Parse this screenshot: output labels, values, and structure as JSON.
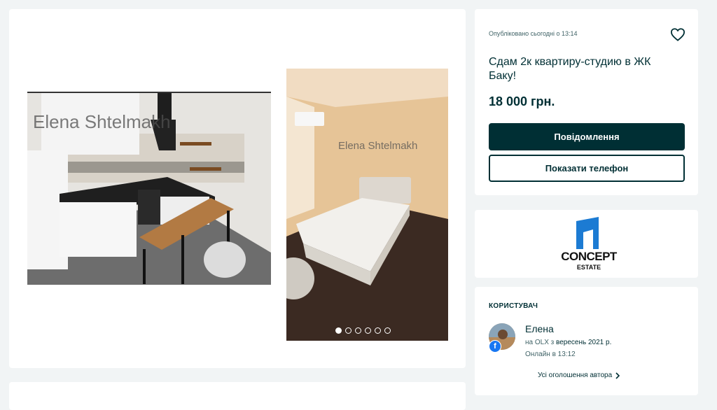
{
  "gallery": {
    "watermark_1": "Elena Shtelmakh",
    "watermark_2": "Elena Shtelmakh",
    "dots": 6,
    "active_dot": 1
  },
  "ad": {
    "published": "Опубліковано сьогодні о 13:14",
    "title": "Сдам 2к квартиру-студию в ЖК Баку!",
    "price": "18 000 грн.",
    "message_button": "Повідомлення",
    "phone_button": "Показати телефон"
  },
  "logo": {
    "word": "CONCEPT",
    "sub": "ESTATE"
  },
  "user": {
    "heading": "КОРИСТУВАЧ",
    "name": "Елена",
    "since_prefix": "на OLX з",
    "since_date": "вересень 2021 р.",
    "online": "Онлайн в 13:12",
    "all_ads": "Усі оголошення автора"
  },
  "colors": {
    "primary": "#002f34",
    "background": "#f1f4f5",
    "facebook": "#1877f2"
  },
  "icons": [
    "heart-icon",
    "chevron-right-icon",
    "facebook-icon"
  ]
}
